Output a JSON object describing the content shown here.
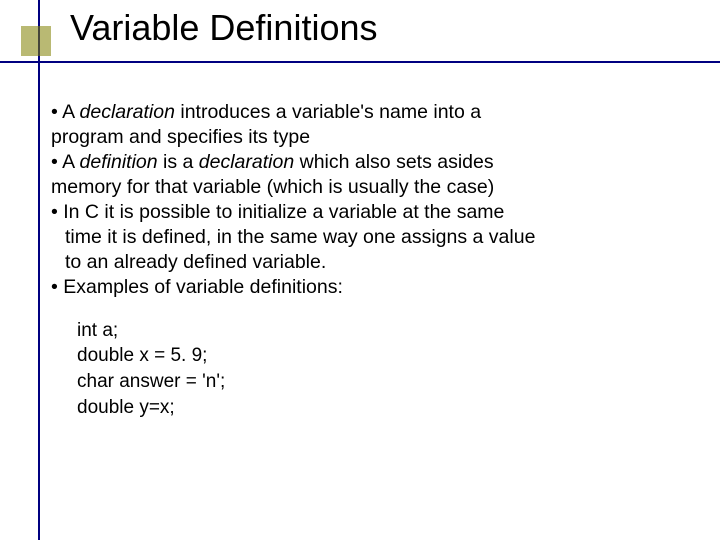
{
  "title": "Variable Definitions",
  "bullets": {
    "b1a": "• A ",
    "b1b": "declaration",
    "b1c": " introduces a variable's name into a",
    "b1d": "program and specifies its type",
    "b2a": "• A ",
    "b2b": "definition",
    "b2c": " is a ",
    "b2d": "declaration",
    "b2e": " which also sets asides",
    "b2f": "memory for that variable (which is usually the case)",
    "b3a": "• In C it is possible to initialize a variable at the same",
    "b3b": "time it is defined, in the same way one assigns a value",
    "b3c": "to an already defined variable.",
    "b4": "• Examples of variable definitions:"
  },
  "examples": {
    "e1": "int a;",
    "e2": "double x = 5. 9;",
    "e3": "char answer = 'n';",
    "e4": "double y=x;"
  }
}
